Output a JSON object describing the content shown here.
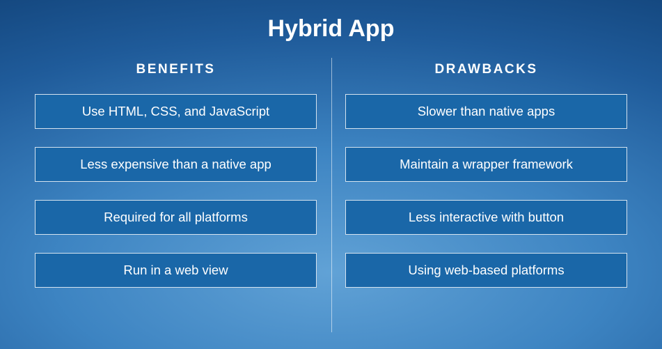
{
  "title": "Hybrid App",
  "columns": {
    "left": {
      "header": "BENEFITS",
      "items": [
        "Use HTML, CSS, and JavaScript",
        "Less expensive than a native app",
        "Required for all platforms",
        "Run in a web view"
      ]
    },
    "right": {
      "header": "DRAWBACKS",
      "items": [
        "Slower than native apps",
        "Maintain a wrapper framework",
        "Less interactive with button",
        "Using web-based platforms"
      ]
    }
  },
  "colors": {
    "item_bg": "#1a67a8",
    "item_border": "rgba(255,255,255,0.82)"
  }
}
